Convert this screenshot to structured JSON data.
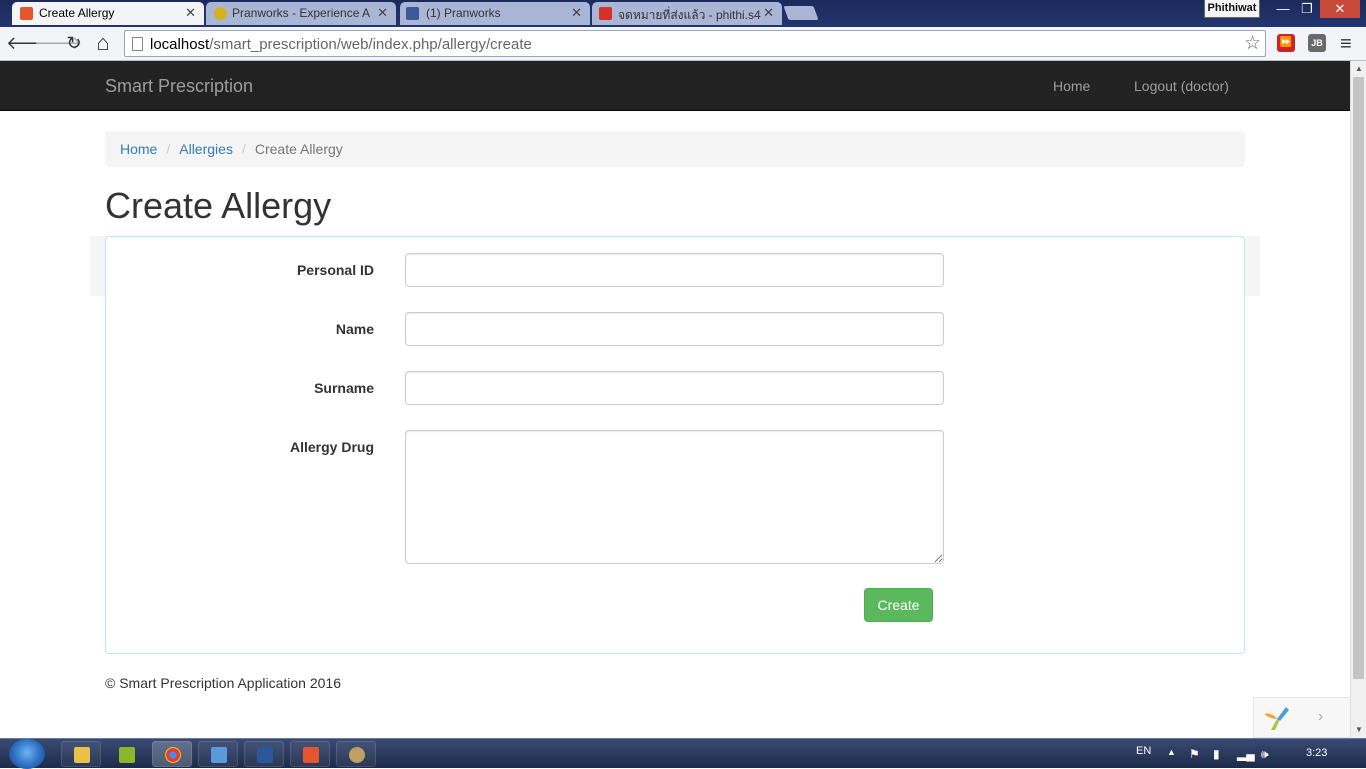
{
  "tabs": [
    {
      "title": "Create Allergy",
      "favicon_color": "#e4572e"
    },
    {
      "title": "Pranworks - Experience A",
      "favicon_color": "#d6b020"
    },
    {
      "title": "(1) Pranworks",
      "favicon_color": "#3b5998"
    },
    {
      "title": "จดหมายที่ส่งแล้ว - phithi.s4",
      "favicon_color": "#d93025"
    }
  ],
  "tab_close": "✕",
  "user_name": "Phithiwat",
  "window_buttons": {
    "minimize": "—",
    "restore": "❐",
    "close": "✕"
  },
  "toolbar": {
    "back_icon": "🡐",
    "forward_icon": "🡒",
    "reload_icon": "↻",
    "home_icon": "⌂",
    "url_host": "localhost",
    "url_path": "/smart_prescription/web/index.php/allergy/create",
    "star_icon": "☆",
    "menu_icon": "≡"
  },
  "extensions": [
    {
      "name": "lastpass-extension-icon",
      "color": "#cc2229",
      "glyph": "⏩"
    },
    {
      "name": "jb-extension-icon",
      "color": "#6a6a6a",
      "glyph": "JB"
    }
  ],
  "app": {
    "brand": "Smart Prescription",
    "nav_home": "Home",
    "nav_logout": "Logout (doctor)"
  },
  "breadcrumb": {
    "home": "Home",
    "allergies": "Allergies",
    "current": "Create Allergy",
    "separator": "/"
  },
  "page_title": "Create Allergy",
  "form": {
    "personal_id_label": "Personal ID",
    "personal_id_value": "",
    "name_label": "Name",
    "name_value": "",
    "surname_label": "Surname",
    "surname_value": "",
    "allergy_drug_label": "Allergy Drug",
    "allergy_drug_value": "",
    "submit_label": "Create"
  },
  "footer": "© Smart Prescription Application 2016",
  "debug_toolbar": {
    "arrow": "›"
  },
  "taskbar": {
    "apps": [
      {
        "name": "explorer",
        "color": "#e8c04a"
      },
      {
        "name": "vmware",
        "color": "#8ab82a"
      },
      {
        "name": "chrome",
        "color": "#e0402f",
        "active": true
      },
      {
        "name": "remote-desktop",
        "color": "#5a9ad8"
      },
      {
        "name": "word",
        "color": "#2b5797"
      },
      {
        "name": "xampp",
        "color": "#e4572e"
      },
      {
        "name": "paint",
        "color": "#c0a060"
      }
    ],
    "lang": "EN",
    "clock": "3:23"
  }
}
